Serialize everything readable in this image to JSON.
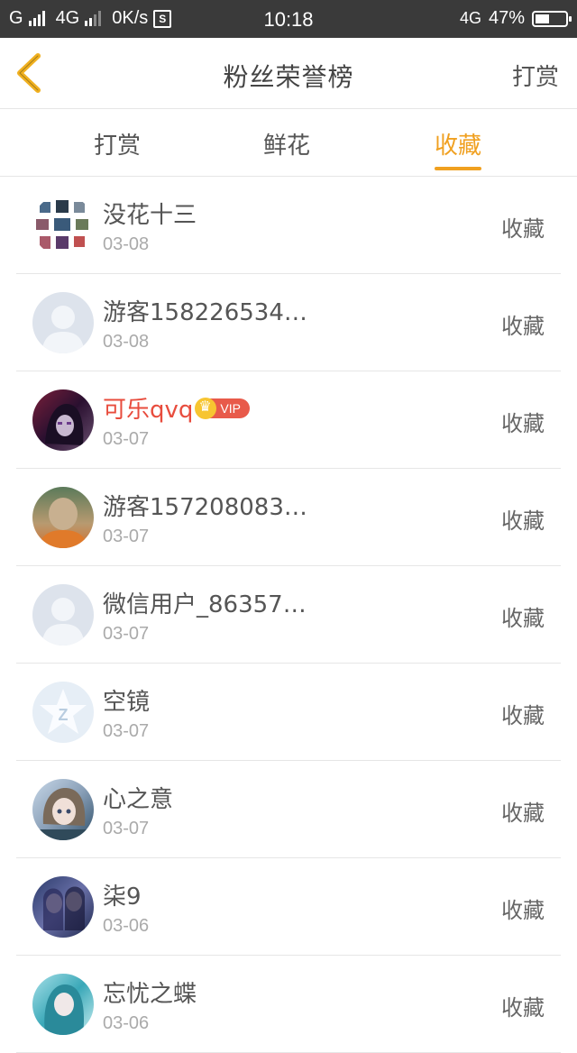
{
  "status_bar": {
    "carrier1": "G",
    "carrier2": "4G",
    "speed": "0K/s",
    "s_icon": "S",
    "time": "10:18",
    "network": "4G",
    "battery": "47%",
    "battery_level": 0.47
  },
  "header": {
    "back_icon": "chevron-left-icon",
    "title": "粉丝荣誉榜",
    "right_action": "打赏"
  },
  "tabs": [
    {
      "label": "打赏",
      "active": false
    },
    {
      "label": "鲜花",
      "active": false
    },
    {
      "label": "收藏",
      "active": true
    }
  ],
  "colors": {
    "accent": "#f0a020",
    "vip_name": "#e84c3d",
    "status_bar_bg": "#3a3a3a"
  },
  "fans": [
    {
      "name": "没花十三",
      "date": "03-08",
      "action": "收藏",
      "avatar": "collage",
      "vip": false
    },
    {
      "name": "游客158226534…",
      "date": "03-08",
      "action": "收藏",
      "avatar": "default-user",
      "vip": false
    },
    {
      "name": "可乐qvq",
      "date": "03-07",
      "action": "收藏",
      "avatar": "anime-dark",
      "vip": true,
      "vip_label": "VIP"
    },
    {
      "name": "游客157208083…",
      "date": "03-07",
      "action": "收藏",
      "avatar": "photo-bald",
      "vip": false
    },
    {
      "name": "微信用户_86357…",
      "date": "03-07",
      "action": "收藏",
      "avatar": "default-user",
      "vip": false
    },
    {
      "name": "空镜",
      "date": "03-07",
      "action": "收藏",
      "avatar": "qq-star",
      "vip": false
    },
    {
      "name": "心之意",
      "date": "03-07",
      "action": "收藏",
      "avatar": "anime-girl",
      "vip": false
    },
    {
      "name": "柒9",
      "date": "03-06",
      "action": "收藏",
      "avatar": "anime-couple",
      "vip": false
    },
    {
      "name": "忘忧之蝶",
      "date": "03-06",
      "action": "收藏",
      "avatar": "anime-teal",
      "vip": false
    }
  ]
}
